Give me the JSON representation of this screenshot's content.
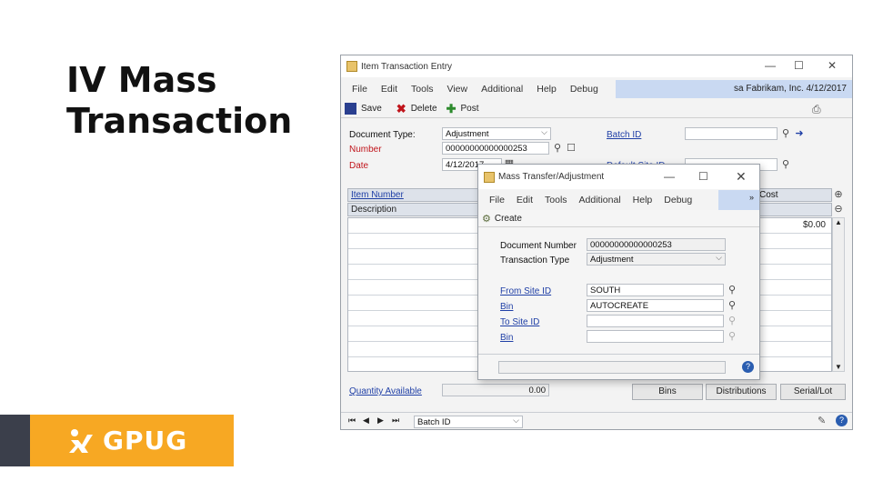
{
  "slide": {
    "title_line1": "IV Mass",
    "title_line2": "Transaction",
    "logo_text": "GPUG"
  },
  "main_window": {
    "title": "Item Transaction Entry",
    "menu": [
      "File",
      "Edit",
      "Tools",
      "View",
      "Additional",
      "Help",
      "Debug"
    ],
    "user_info": "sa  Fabrikam, Inc.  4/12/2017",
    "toolbar": {
      "save": "Save",
      "delete": "Delete",
      "post": "Post"
    },
    "fields": {
      "document_type_label": "Document Type:",
      "document_type_value": "Adjustment",
      "number_label": "Number",
      "number_value": "00000000000000253",
      "date_label": "Date",
      "date_value": "4/12/2017",
      "batch_id_label": "Batch ID",
      "default_site_label": "Default Site ID"
    },
    "grid": {
      "col_item_number": "Item Number",
      "col_description": "Description",
      "col_cost": "Cost",
      "first_cost": "$0.00"
    },
    "footer": {
      "quantity_label": "Quantity Available",
      "quantity_value": "0.00",
      "bins": "Bins",
      "distributions": "Distributions",
      "serial_lot": "Serial/Lot",
      "sort_value": "Batch ID"
    }
  },
  "dialog": {
    "title": "Mass Transfer/Adjustment",
    "menu": [
      "File",
      "Edit",
      "Tools",
      "Additional",
      "Help",
      "Debug"
    ],
    "toolbar_create": "Create",
    "fields": {
      "doc_number_label": "Document Number",
      "doc_number_value": "00000000000000253",
      "trx_type_label": "Transaction Type",
      "trx_type_value": "Adjustment",
      "from_site_label": "From Site ID",
      "from_site_value": "SOUTH",
      "bin1_label": "Bin",
      "bin1_value": "AUTOCREATE",
      "to_site_label": "To Site ID",
      "bin2_label": "Bin"
    }
  },
  "colors": {
    "accent": "#f7a823",
    "dark": "#3b3f4b",
    "link": "#1f3fa6",
    "required": "#c0141b"
  }
}
